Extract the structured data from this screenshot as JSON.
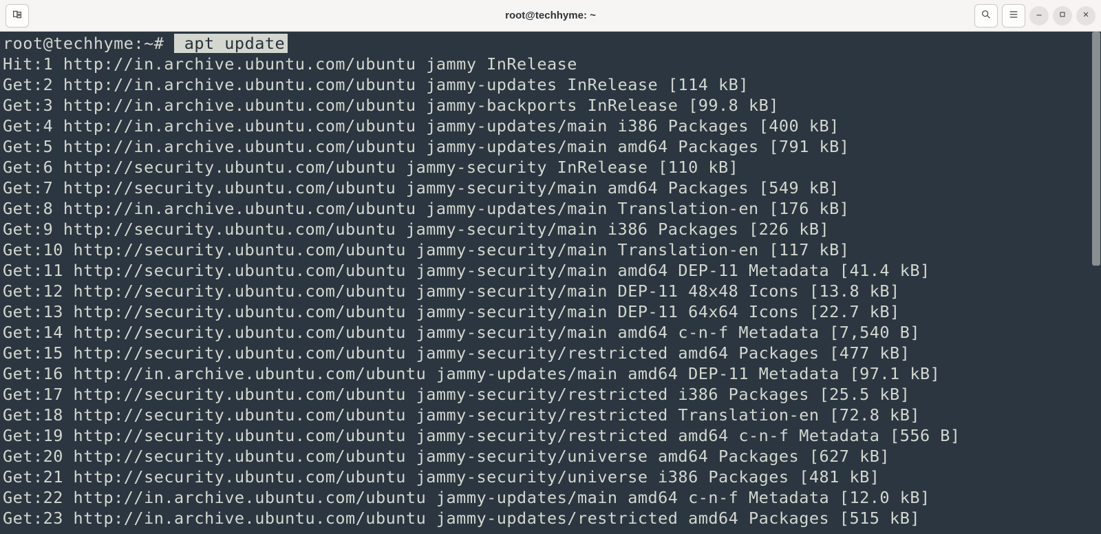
{
  "window": {
    "title": "root@techhyme: ~"
  },
  "prompt": {
    "text": "root@techhyme:~#",
    "command": "apt update"
  },
  "output": [
    "Hit:1 http://in.archive.ubuntu.com/ubuntu jammy InRelease",
    "Get:2 http://in.archive.ubuntu.com/ubuntu jammy-updates InRelease [114 kB]",
    "Get:3 http://in.archive.ubuntu.com/ubuntu jammy-backports InRelease [99.8 kB]",
    "Get:4 http://in.archive.ubuntu.com/ubuntu jammy-updates/main i386 Packages [400 kB]",
    "Get:5 http://in.archive.ubuntu.com/ubuntu jammy-updates/main amd64 Packages [791 kB]",
    "Get:6 http://security.ubuntu.com/ubuntu jammy-security InRelease [110 kB]",
    "Get:7 http://security.ubuntu.com/ubuntu jammy-security/main amd64 Packages [549 kB]",
    "Get:8 http://in.archive.ubuntu.com/ubuntu jammy-updates/main Translation-en [176 kB]",
    "Get:9 http://security.ubuntu.com/ubuntu jammy-security/main i386 Packages [226 kB]",
    "Get:10 http://security.ubuntu.com/ubuntu jammy-security/main Translation-en [117 kB]",
    "Get:11 http://security.ubuntu.com/ubuntu jammy-security/main amd64 DEP-11 Metadata [41.4 kB]",
    "Get:12 http://security.ubuntu.com/ubuntu jammy-security/main DEP-11 48x48 Icons [13.8 kB]",
    "Get:13 http://security.ubuntu.com/ubuntu jammy-security/main DEP-11 64x64 Icons [22.7 kB]",
    "Get:14 http://security.ubuntu.com/ubuntu jammy-security/main amd64 c-n-f Metadata [7,540 B]",
    "Get:15 http://security.ubuntu.com/ubuntu jammy-security/restricted amd64 Packages [477 kB]",
    "Get:16 http://in.archive.ubuntu.com/ubuntu jammy-updates/main amd64 DEP-11 Metadata [97.1 kB]",
    "Get:17 http://security.ubuntu.com/ubuntu jammy-security/restricted i386 Packages [25.5 kB]",
    "Get:18 http://security.ubuntu.com/ubuntu jammy-security/restricted Translation-en [72.8 kB]",
    "Get:19 http://security.ubuntu.com/ubuntu jammy-security/restricted amd64 c-n-f Metadata [556 B]",
    "Get:20 http://security.ubuntu.com/ubuntu jammy-security/universe amd64 Packages [627 kB]",
    "Get:21 http://security.ubuntu.com/ubuntu jammy-security/universe i386 Packages [481 kB]",
    "Get:22 http://in.archive.ubuntu.com/ubuntu jammy-updates/main amd64 c-n-f Metadata [12.0 kB]",
    "Get:23 http://in.archive.ubuntu.com/ubuntu jammy-updates/restricted amd64 Packages [515 kB]"
  ]
}
